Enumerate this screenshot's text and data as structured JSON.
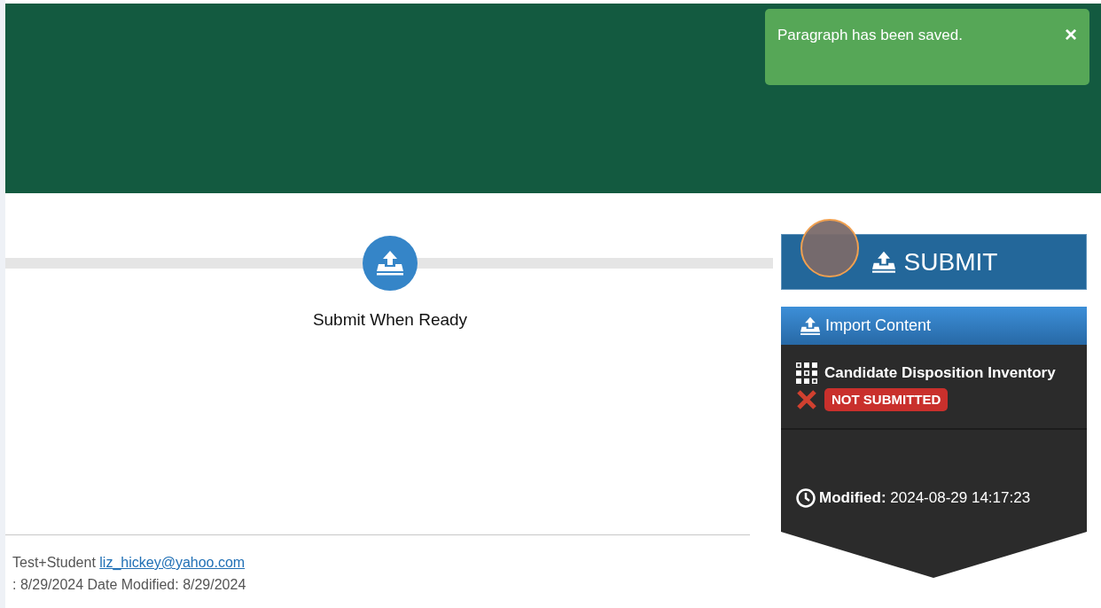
{
  "toast": {
    "message": "Paragraph has been saved.",
    "close": "×"
  },
  "progress": {
    "step_label": "Submit When Ready"
  },
  "footer": {
    "author": "Test+Student",
    "email": "liz_hickey@yahoo.com",
    "dates": ": 8/29/2024 Date Modified: 8/29/2024"
  },
  "sidebar": {
    "submit_button": "SUBMIT",
    "click_indicator": true,
    "header": "Import Content",
    "item": {
      "title": "Candidate Disposition Inventory",
      "submitted": false,
      "badge": "NOT SUBMITTED"
    },
    "modified_label": "Modified:",
    "modified_value": "2024-08-29 14:17:23"
  }
}
